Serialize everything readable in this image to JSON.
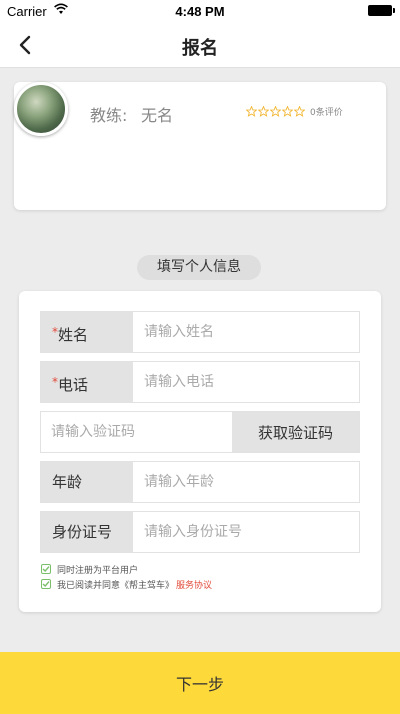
{
  "status_bar": {
    "carrier": "Carrier",
    "time": "4:48 PM",
    "wifi_icon": "wifi-icon",
    "battery_icon": "battery-icon"
  },
  "nav": {
    "title": "报名",
    "back_icon": "chevron-left-icon"
  },
  "coach": {
    "label": "教练:",
    "name": "无名",
    "rating": 0,
    "max_rating": 5,
    "review_count_text": "0条评价"
  },
  "section_title": "填写个人信息",
  "form": {
    "name": {
      "label": "姓名",
      "required_mark": "*",
      "placeholder": "请输入姓名",
      "value": ""
    },
    "phone": {
      "label": "电话",
      "required_mark": "*",
      "placeholder": "请输入电话",
      "value": ""
    },
    "code": {
      "placeholder": "请输入验证码",
      "value": "",
      "button_label": "获取验证码"
    },
    "age": {
      "label": "年龄",
      "placeholder": "请输入年龄",
      "value": ""
    },
    "id_card": {
      "label": "身份证号",
      "placeholder": "请输入身份证号",
      "value": ""
    }
  },
  "agreements": {
    "register_text": "同时注册为平台用户",
    "register_checked": true,
    "terms_text": "我已阅读并同意《帮主驾车》",
    "terms_link": "服务协议",
    "terms_checked": true
  },
  "next_button_label": "下一步",
  "colors": {
    "accent_yellow": "#fdd93a",
    "required_red": "#e24a3a",
    "check_green": "#7bbf6a",
    "star_gold": "#f2b632"
  }
}
